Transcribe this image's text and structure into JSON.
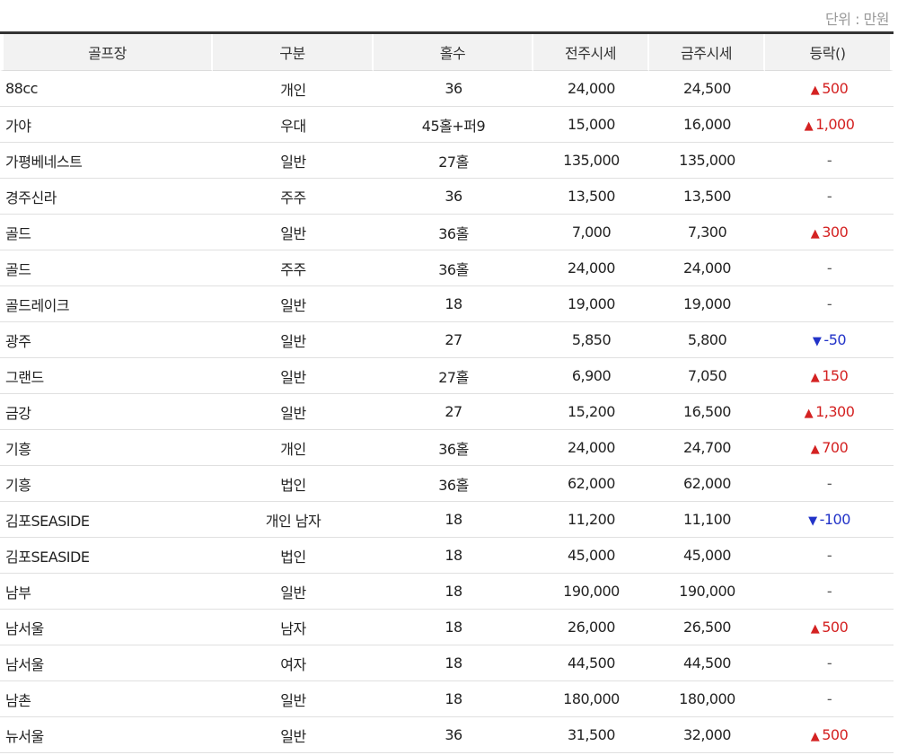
{
  "unit_label": "단위 : 만원",
  "headers": [
    "골프장",
    "구분",
    "홀수",
    "전주시세",
    "금주시세",
    "등락()"
  ],
  "colors": {
    "up": "#d42222",
    "down": "#2233c8"
  },
  "rows": [
    {
      "course": "88cc",
      "type": "개인",
      "holes": "36",
      "prev": "24,000",
      "curr": "24,500",
      "dir": "up",
      "arrow": "▲",
      "change": "500"
    },
    {
      "course": "가야",
      "type": "우대",
      "holes": "45홀+퍼9",
      "prev": "15,000",
      "curr": "16,000",
      "dir": "up",
      "arrow": "▲",
      "change": "1,000"
    },
    {
      "course": "가평베네스트",
      "type": "일반",
      "holes": "27홀",
      "prev": "135,000",
      "curr": "135,000",
      "dir": "flat",
      "arrow": "",
      "change": "-"
    },
    {
      "course": "경주신라",
      "type": "주주",
      "holes": "36",
      "prev": "13,500",
      "curr": "13,500",
      "dir": "flat",
      "arrow": "",
      "change": "-"
    },
    {
      "course": "골드",
      "type": "일반",
      "holes": "36홀",
      "prev": "7,000",
      "curr": "7,300",
      "dir": "up",
      "arrow": "▲",
      "change": "300"
    },
    {
      "course": "골드",
      "type": "주주",
      "holes": "36홀",
      "prev": "24,000",
      "curr": "24,000",
      "dir": "flat",
      "arrow": "",
      "change": "-"
    },
    {
      "course": "골드레이크",
      "type": "일반",
      "holes": "18",
      "prev": "19,000",
      "curr": "19,000",
      "dir": "flat",
      "arrow": "",
      "change": "-"
    },
    {
      "course": "광주",
      "type": "일반",
      "holes": "27",
      "prev": "5,850",
      "curr": "5,800",
      "dir": "down",
      "arrow": "▼",
      "change": "-50"
    },
    {
      "course": "그랜드",
      "type": "일반",
      "holes": "27홀",
      "prev": "6,900",
      "curr": "7,050",
      "dir": "up",
      "arrow": "▲",
      "change": "150"
    },
    {
      "course": "금강",
      "type": "일반",
      "holes": "27",
      "prev": "15,200",
      "curr": "16,500",
      "dir": "up",
      "arrow": "▲",
      "change": "1,300"
    },
    {
      "course": "기흥",
      "type": "개인",
      "holes": "36홀",
      "prev": "24,000",
      "curr": "24,700",
      "dir": "up",
      "arrow": "▲",
      "change": "700"
    },
    {
      "course": "기흥",
      "type": "법인",
      "holes": "36홀",
      "prev": "62,000",
      "curr": "62,000",
      "dir": "flat",
      "arrow": "",
      "change": "-"
    },
    {
      "course": "김포SEASIDE",
      "type": "개인 남자",
      "holes": "18",
      "prev": "11,200",
      "curr": "11,100",
      "dir": "down",
      "arrow": "▼",
      "change": "-100"
    },
    {
      "course": "김포SEASIDE",
      "type": "법인",
      "holes": "18",
      "prev": "45,000",
      "curr": "45,000",
      "dir": "flat",
      "arrow": "",
      "change": "-"
    },
    {
      "course": "남부",
      "type": "일반",
      "holes": "18",
      "prev": "190,000",
      "curr": "190,000",
      "dir": "flat",
      "arrow": "",
      "change": "-"
    },
    {
      "course": "남서울",
      "type": "남자",
      "holes": "18",
      "prev": "26,000",
      "curr": "26,500",
      "dir": "up",
      "arrow": "▲",
      "change": "500"
    },
    {
      "course": "남서울",
      "type": "여자",
      "holes": "18",
      "prev": "44,500",
      "curr": "44,500",
      "dir": "flat",
      "arrow": "",
      "change": "-"
    },
    {
      "course": "남촌",
      "type": "일반",
      "holes": "18",
      "prev": "180,000",
      "curr": "180,000",
      "dir": "flat",
      "arrow": "",
      "change": "-"
    },
    {
      "course": "뉴서울",
      "type": "일반",
      "holes": "36",
      "prev": "31,500",
      "curr": "32,000",
      "dir": "up",
      "arrow": "▲",
      "change": "500"
    }
  ]
}
